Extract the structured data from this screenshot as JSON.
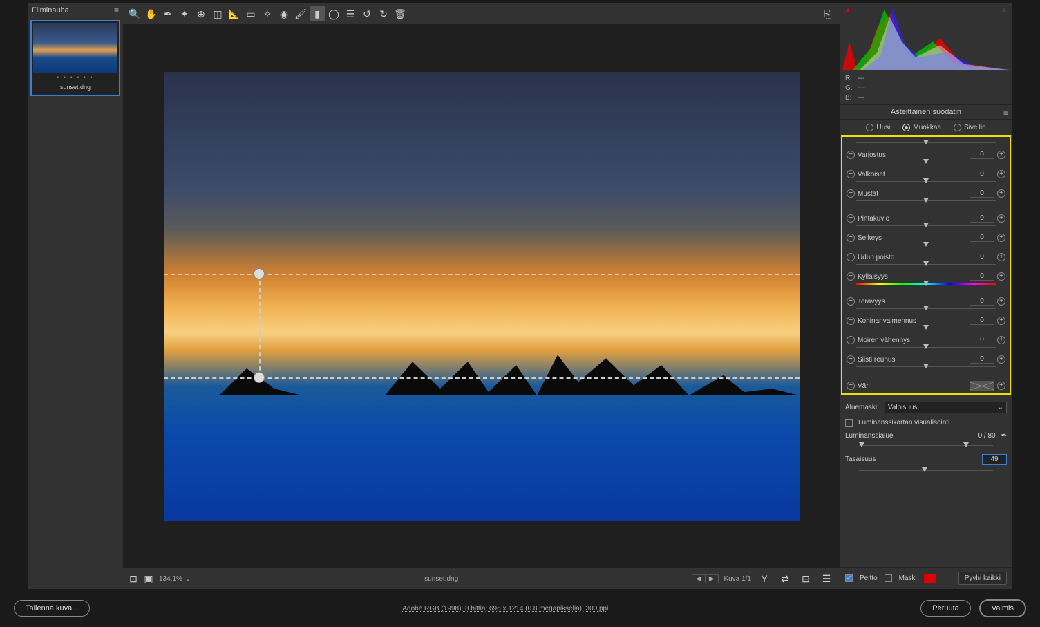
{
  "filmstrip": {
    "header": "Filminauha",
    "thumb_name": "sunset.dng",
    "dots": "• • • • • •"
  },
  "toolbar": {
    "tools": [
      "zoom",
      "hand",
      "white-balance",
      "color-sampler",
      "target",
      "crop",
      "straighten",
      "transform",
      "heal",
      "clone",
      "brush",
      "gradient-rect",
      "gradient-radial",
      "list",
      "undo",
      "redo",
      "trash"
    ],
    "fullscreen": "⤢"
  },
  "histogram": {
    "r_label": "R:",
    "g_label": "G:",
    "b_label": "B:",
    "r_val": "---",
    "g_val": "---",
    "b_val": "---"
  },
  "panel": {
    "title": "Asteittainen suodatin",
    "modes": {
      "new": "Uusi",
      "edit": "Muokkaa",
      "brush": "Sivellin",
      "selected": "edit"
    }
  },
  "sliders_a": [
    {
      "label": "Varjostus",
      "value": "0"
    },
    {
      "label": "Valkoiset",
      "value": "0"
    },
    {
      "label": "Mustat",
      "value": "0"
    }
  ],
  "sliders_b": [
    {
      "label": "Pintakuvio",
      "value": "0"
    },
    {
      "label": "Selkeys",
      "value": "0"
    },
    {
      "label": "Udun poisto",
      "value": "0"
    },
    {
      "label": "Kylläisyys",
      "value": "0",
      "rainbow": true
    }
  ],
  "sliders_c": [
    {
      "label": "Terävyys",
      "value": "0"
    },
    {
      "label": "Kohinanvaimennus",
      "value": "0"
    },
    {
      "label": "Moiren vähennys",
      "value": "0"
    },
    {
      "label": "Siisti reunus",
      "value": "0"
    }
  ],
  "color_row": {
    "label": "Väri"
  },
  "mask": {
    "label": "Aluemaski:",
    "dropdown": "Valoisuus",
    "viz_label": "Luminanssikartan visualisointi",
    "range_label": "Luminanssialue",
    "range_value": "0 / 80",
    "smooth_label": "Tasaisuus",
    "smooth_value": "49"
  },
  "overlay": {
    "peitto_label": "Peitto",
    "maski_label": "Maski",
    "clear_label": "Pyyhi kaikki"
  },
  "status": {
    "zoom": "134.1%",
    "filename": "sunset.dng",
    "counter": "Kuva 1/1"
  },
  "footer": {
    "save": "Tallenna kuva...",
    "meta": "Adobe RGB (1998); 8 bittiä; 696 x 1214 (0.8 megapikseliä); 300 ppi",
    "cancel": "Peruuta",
    "done": "Valmis"
  }
}
